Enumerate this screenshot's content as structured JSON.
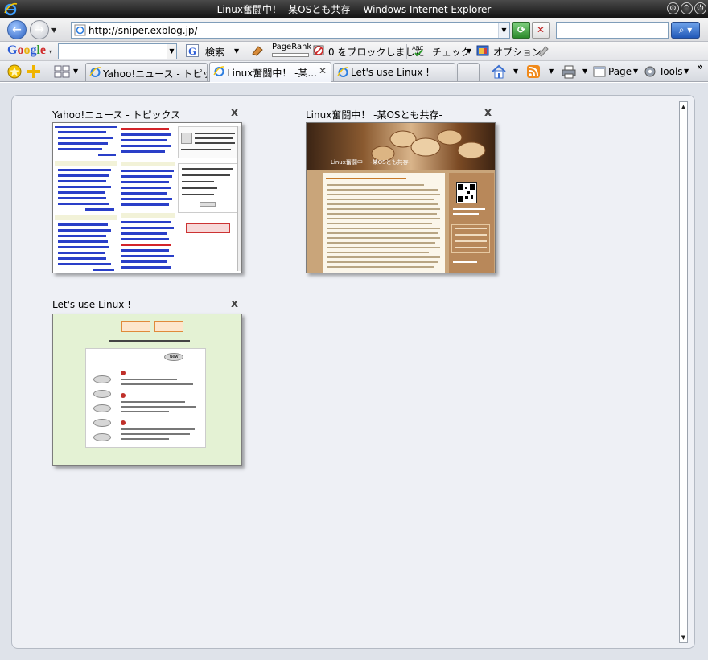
{
  "window": {
    "title": "Linux奮闘中！ -某OSとも共存- - Windows Internet Explorer",
    "controls": [
      "minimize",
      "maximize",
      "close"
    ]
  },
  "address_bar": {
    "url": "http://sniper.exblog.jp/",
    "search_placeholder": ""
  },
  "google_toolbar": {
    "logo": "Google",
    "search_value": "",
    "search_label": "検索",
    "pagerank_label": "PageRank",
    "blocked_label": "0 をブロックしました",
    "check_label": "チェック",
    "options_label": "オプション"
  },
  "tab_row": {
    "tabs": [
      {
        "label": "Yahoo!ニュース - トピックス",
        "active": false
      },
      {
        "label": "Linux奮闘中！ -某...",
        "active": true
      },
      {
        "label": "Let's use Linux !",
        "active": false
      }
    ],
    "page_label": "Page",
    "tools_label": "Tools",
    "overflow": "»"
  },
  "quick_tabs": [
    {
      "title": "Yahoo!ニュース - トピックス",
      "close": "x"
    },
    {
      "title": "Linux奮闘中！ -某OSとも共存-",
      "close": "x"
    },
    {
      "title": "Let's use Linux !",
      "close": "x"
    }
  ],
  "thumb_text": {
    "blog_header": "Linux奮闘中！ -某OSとも共存-",
    "linux_new": "New",
    "linux_buttons": [
      "Top(本)",
      "初めての",
      "LINKs",
      "ドライバ",
      "BAN"
    ]
  }
}
